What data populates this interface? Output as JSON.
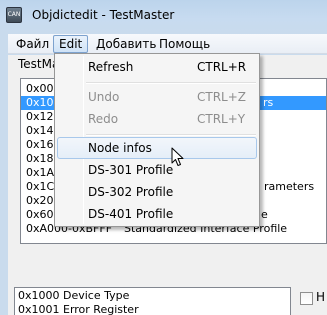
{
  "window": {
    "title": "Objdictedit - TestMaster",
    "icon": "can-app-icon",
    "icon_text": "CAN"
  },
  "menubar": {
    "items": [
      {
        "label": "Файл",
        "active": false
      },
      {
        "label": "Edit",
        "active": true
      },
      {
        "label": "Добавить",
        "active": false
      },
      {
        "label": "Помощь",
        "active": false
      }
    ]
  },
  "tab": {
    "label": "TestMa"
  },
  "index_list": {
    "rows": [
      {
        "index": "0x000",
        "name": "",
        "selected": false
      },
      {
        "index": "0x100",
        "name": "",
        "tail": "rs",
        "selected": true
      },
      {
        "index": "0x120",
        "name": "",
        "selected": false
      },
      {
        "index": "0x140",
        "name": "",
        "selected": false
      },
      {
        "index": "0x160",
        "name": "",
        "selected": false
      },
      {
        "index": "0x180",
        "name": "",
        "selected": false
      },
      {
        "index": "0x1A0",
        "name": "",
        "selected": false
      },
      {
        "index": "0x1C0",
        "name": "",
        "tail": "rameters",
        "selected": false
      },
      {
        "index": "0x200",
        "name": "",
        "selected": false
      },
      {
        "index": "0x600",
        "name": "",
        "tail": "e",
        "selected": false
      },
      {
        "index": "0xA000-0xBFFF",
        "name": "Standardized Interface Profile",
        "selected": false
      }
    ]
  },
  "subindex_list": {
    "rows": [
      {
        "index": "0x1000",
        "name": "Device Type"
      },
      {
        "index": "0x1001",
        "name": "Error Register"
      }
    ]
  },
  "side_panel": {
    "checkbox_checked": false,
    "label": "H"
  },
  "edit_menu": {
    "items": [
      {
        "label": "Refresh",
        "shortcut": "CTRL+R",
        "enabled": true,
        "hover": false
      },
      {
        "separator": true
      },
      {
        "label": "Undo",
        "shortcut": "CTRL+Z",
        "enabled": false,
        "hover": false
      },
      {
        "label": "Redo",
        "shortcut": "CTRL+Y",
        "enabled": false,
        "hover": false
      },
      {
        "separator": true
      },
      {
        "label": "Node infos",
        "shortcut": "",
        "enabled": true,
        "hover": true
      },
      {
        "label": "DS-301 Profile",
        "shortcut": "",
        "enabled": true,
        "hover": false
      },
      {
        "label": "DS-302 Profile",
        "shortcut": "",
        "enabled": true,
        "hover": false
      },
      {
        "label": "DS-401 Profile",
        "shortcut": "",
        "enabled": true,
        "hover": false
      }
    ]
  },
  "colors": {
    "selection": "#3399ff",
    "menu_hover_border": "#a8c8eb",
    "frame": "#c9dbed"
  }
}
